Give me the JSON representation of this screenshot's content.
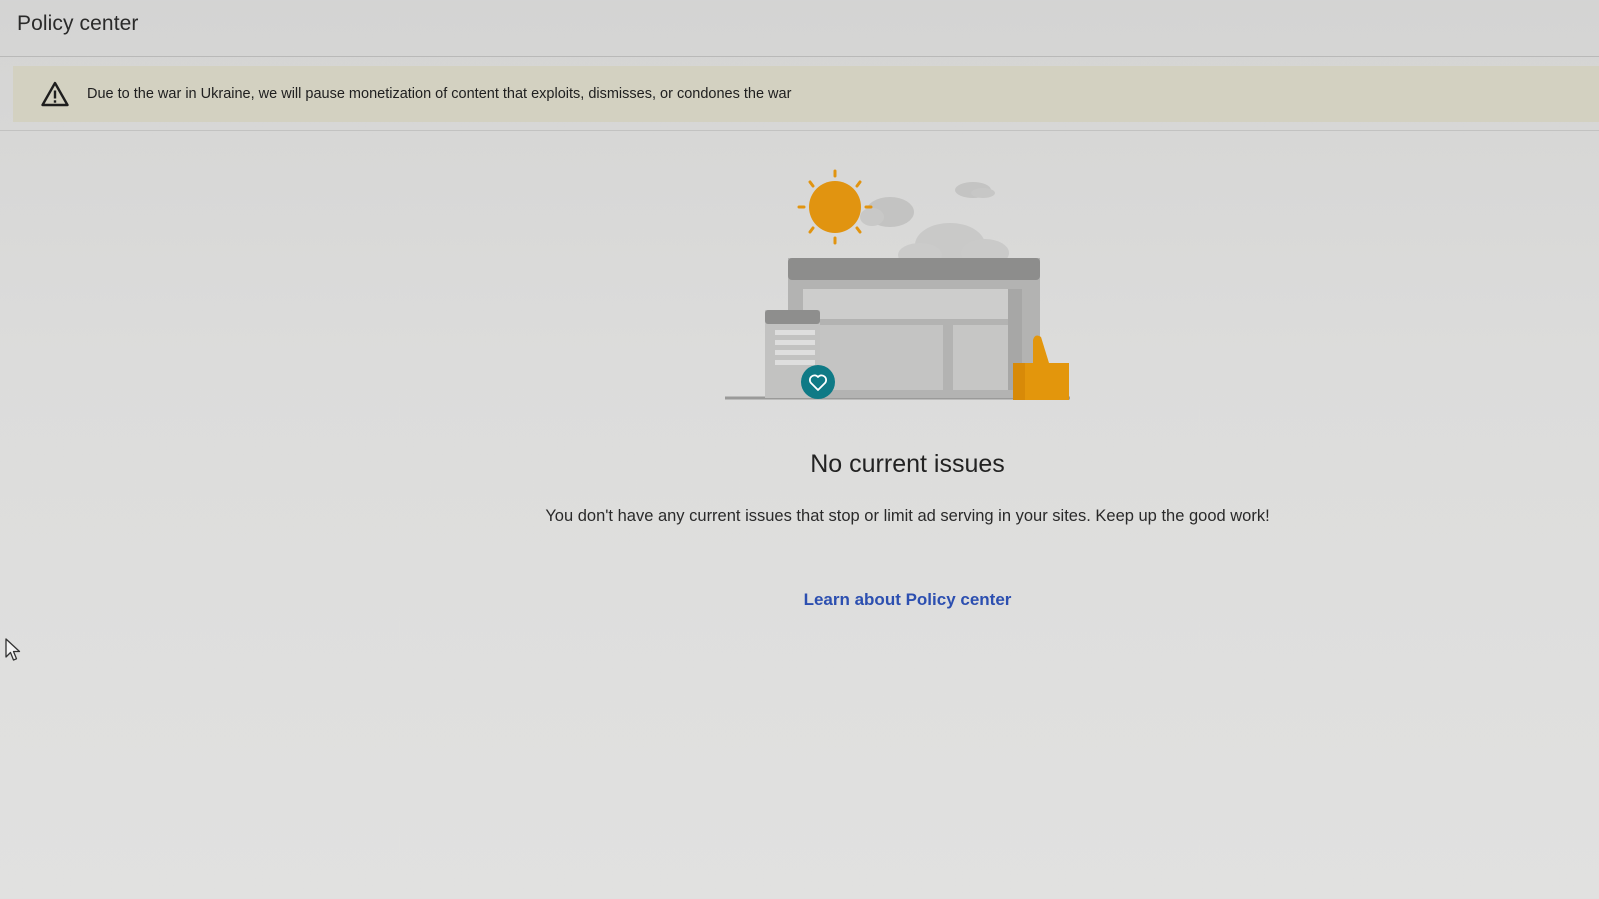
{
  "header": {
    "title": "Policy center"
  },
  "banner": {
    "icon": "warning-triangle-icon",
    "text": "Due to the war in Ukraine, we will pause monetization of content that exploits, dismisses, or condones the war",
    "background": "#d3d1c1"
  },
  "empty_state": {
    "illustration": "storefront-sun-thumbs-up-illustration",
    "title": "No current issues",
    "description": "You don't have any current issues that stop or limit ad serving in your sites. Keep up the good work!",
    "link_label": "Learn about Policy center",
    "link_color": "#2c4fb0"
  },
  "colors": {
    "sun": "#e19410",
    "heart_badge": "#0f7a86",
    "thumb": "#e3960c"
  }
}
